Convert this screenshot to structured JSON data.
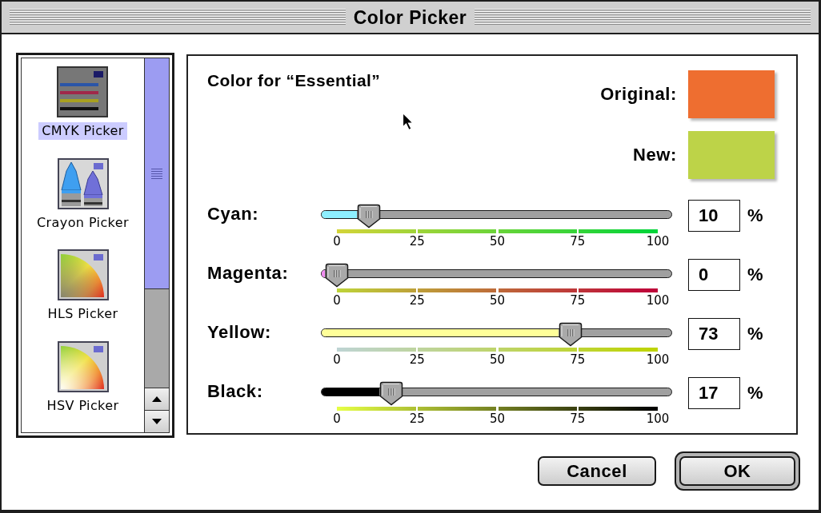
{
  "window": {
    "title": "Color Picker"
  },
  "picker_list": [
    {
      "kind": "cmyk",
      "label": "CMYK Picker",
      "selected": true
    },
    {
      "kind": "crayon",
      "label": "Crayon Picker",
      "selected": false
    },
    {
      "kind": "hls",
      "label": "HLS Picker",
      "selected": false
    },
    {
      "kind": "hsv",
      "label": "HSV Picker",
      "selected": false
    }
  ],
  "heading": "Color for “Essential”",
  "swatches": [
    {
      "label": "Original:",
      "color": "#ee6e30"
    },
    {
      "label": "New:",
      "color": "#bdd348"
    }
  ],
  "sliders": [
    {
      "label": "Cyan:",
      "color": "#8ef0ff",
      "level": 0.1,
      "ticks": [
        "0",
        "25",
        "50",
        "75",
        "100"
      ],
      "value": "10",
      "unit": "%"
    },
    {
      "label": "Magenta:",
      "color": "#f08cf0",
      "level": 0.0,
      "ticks": [
        "0",
        "25",
        "50",
        "75",
        "100"
      ],
      "value": "0",
      "unit": "%"
    },
    {
      "label": "Yellow:",
      "color": "#ffff99",
      "level": 0.73,
      "ticks": [
        "0",
        "25",
        "50",
        "75",
        "100"
      ],
      "value": "73",
      "unit": "%"
    },
    {
      "label": "Black:",
      "color": "#000000",
      "level": 0.17,
      "ticks": [
        "0",
        "25",
        "50",
        "75",
        "100"
      ],
      "value": "17",
      "unit": "%"
    }
  ],
  "buttons": [
    {
      "label": "Cancel",
      "default": false
    },
    {
      "label": "OK",
      "default": true
    }
  ]
}
